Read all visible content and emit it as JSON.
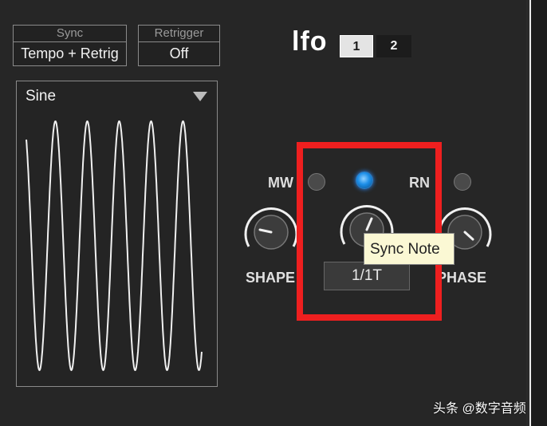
{
  "sync": {
    "title": "Sync",
    "value": "Tempo + Retrig"
  },
  "retrigger": {
    "title": "Retrigger",
    "value": "Off"
  },
  "lfo": {
    "title": "lfo",
    "tabs": [
      {
        "label": "1",
        "active": true
      },
      {
        "label": "2",
        "active": false
      }
    ]
  },
  "waveform": {
    "label": "Sine",
    "cycles": 5.5
  },
  "mod": {
    "mw_label": "MW",
    "rn_label": "RN",
    "sync_led_active": true
  },
  "knobs": {
    "shape": {
      "label": "SHAPE"
    },
    "phase": {
      "label": "PHASE"
    }
  },
  "sync_note": {
    "value": "1/1T",
    "tooltip": "Sync Note"
  },
  "colors": {
    "highlight": "#ee1f1f",
    "led_on": "#1c8ee8",
    "tooltip_bg": "#fbf8d4"
  },
  "watermark": "头条 @数字音频"
}
